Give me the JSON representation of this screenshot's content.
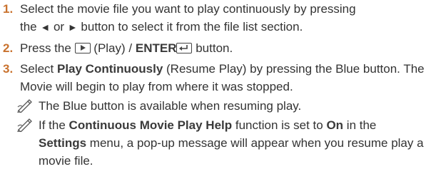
{
  "steps": [
    {
      "number": "1.",
      "line1_a": "Select the movie file you want to play continuously by pressing",
      "line2_a": "the",
      "left_arrow": "◄",
      "line2_b": "or",
      "right_arrow": "►",
      "line2_c": "button to select it from the file list section."
    },
    {
      "number": "2.",
      "text_a": "Press the",
      "text_b": "(Play) /",
      "enter_label": "ENTER",
      "text_c": "button."
    },
    {
      "number": "3.",
      "text_a": "Select",
      "bold_1": "Play Continuously",
      "text_b": "(Resume Play) by pressing the Blue button. The Movie will begin to play from where it was stopped."
    }
  ],
  "notes": [
    {
      "text": "The Blue button is available when resuming play."
    },
    {
      "text_a": "If the",
      "bold_1": "Continuous Movie Play Help",
      "text_b": "function is set to",
      "bold_2": "On",
      "text_c": "in the",
      "bold_3": "Settings",
      "text_d": "menu, a pop-up message will appear when you resume play a movie file."
    }
  ],
  "icons": {
    "note_icon": "pencil-note-icon",
    "play_key": "play-key-icon",
    "enter_key": "enter-key-icon"
  },
  "colors": {
    "step_number": "#c9722e",
    "text": "#333333"
  }
}
